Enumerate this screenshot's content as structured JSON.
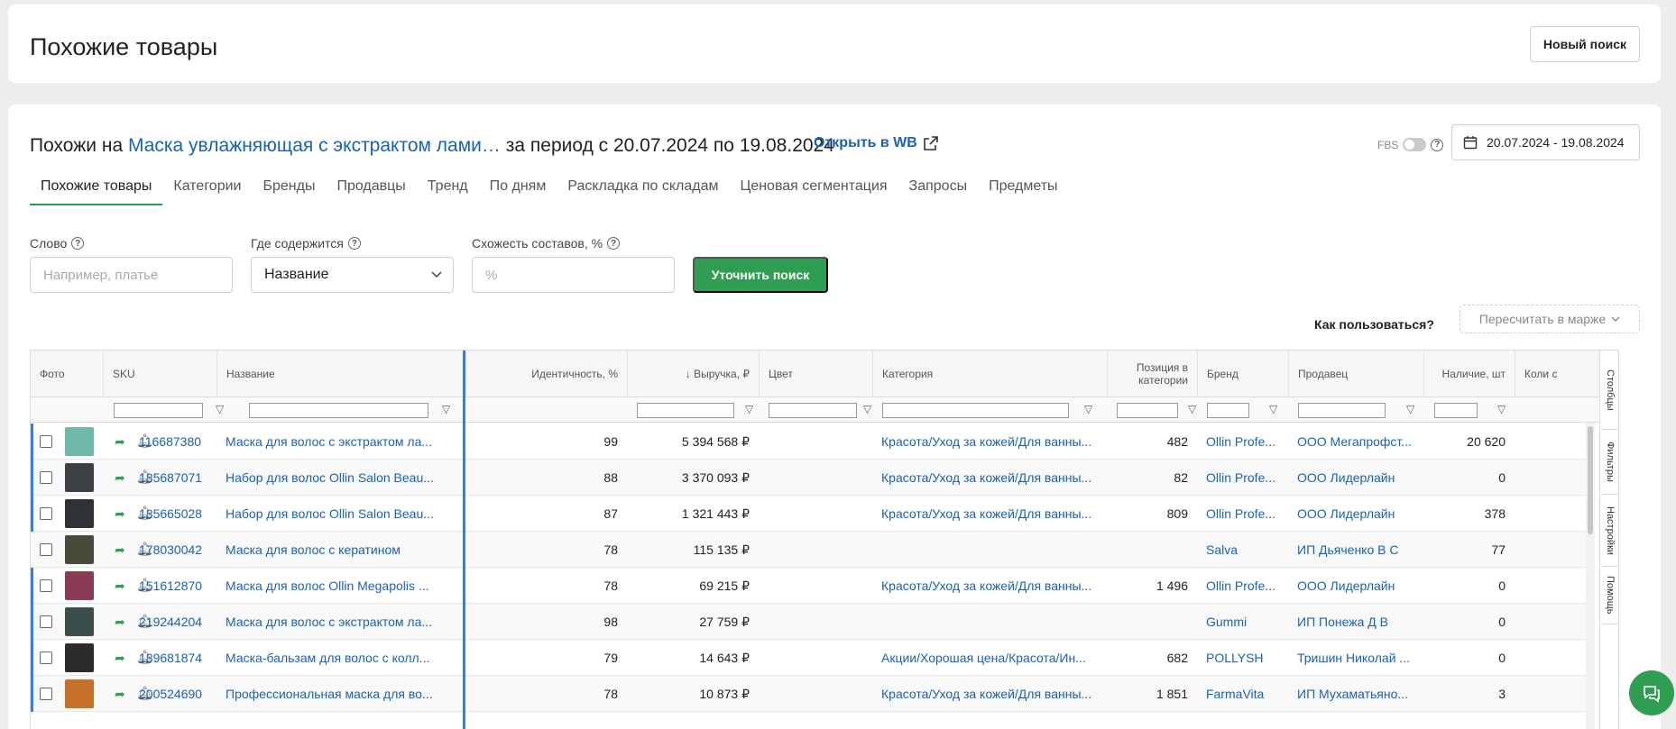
{
  "page": {
    "title": "Похожие товары",
    "new_search": "Новый поиск"
  },
  "heading": {
    "prefix": "Похожи на",
    "product_link": "Маска увлажняющая с экстрактом лами…",
    "period": "за период с 20.07.2024 по 19.08.2024",
    "open_wb": "Открыть в WB"
  },
  "fbs": {
    "label": "FBS"
  },
  "date_range": "20.07.2024 - 19.08.2024",
  "tabs": [
    "Похожие товары",
    "Категории",
    "Бренды",
    "Продавцы",
    "Тренд",
    "По дням",
    "Раскладка по складам",
    "Ценовая сегментация",
    "Запросы",
    "Предметы"
  ],
  "filters": {
    "word_label": "Слово",
    "word_placeholder": "Например, платье",
    "where_label": "Где содержится",
    "where_value": "Название",
    "similarity_label": "Схожесть составов, %",
    "similarity_placeholder": "%",
    "refine_button": "Уточнить поиск"
  },
  "howto": "Как пользоваться?",
  "recalc": "Пересчитать в марже",
  "columns": {
    "photo": "Фото",
    "sku": "SKU",
    "name": "Название",
    "identity": "Идентичность, %",
    "revenue": "↓ Выручка, ₽",
    "color": "Цвет",
    "category": "Категория",
    "position": "Позиция в категории",
    "brand": "Бренд",
    "seller": "Продавец",
    "stock": "Наличие, шт",
    "count": "Коли с"
  },
  "rows": [
    {
      "sku": "116687380",
      "name": "Маска для волос с экстрактом ла...",
      "identity": "99",
      "revenue": "5 394 568 ₽",
      "category": "Красота/Уход за кожей/Для ванны...",
      "position": "482",
      "brand": "Ollin Profe...",
      "seller": "ООО Мегапрофст...",
      "stock": "20 620",
      "thumb": "#6fb7a8"
    },
    {
      "sku": "185687071",
      "name": "Набор для волос Ollin Salon Beau...",
      "identity": "88",
      "revenue": "3 370 093 ₽",
      "category": "Красота/Уход за кожей/Для ванны...",
      "position": "82",
      "brand": "Ollin Profe...",
      "seller": "ООО Лидерлайн",
      "stock": "0",
      "thumb": "#3c3f44"
    },
    {
      "sku": "185665028",
      "name": "Набор для волос Ollin Salon Beau...",
      "identity": "87",
      "revenue": "1 321 443 ₽",
      "category": "Красота/Уход за кожей/Для ванны...",
      "position": "809",
      "brand": "Ollin Profe...",
      "seller": "ООО Лидерлайн",
      "stock": "378",
      "thumb": "#2e3136"
    },
    {
      "sku": "178030042",
      "name": "Маска для волос с кератином",
      "identity": "78",
      "revenue": "115 135 ₽",
      "category": "",
      "position": "",
      "brand": "Salva",
      "seller": "ИП Дьяченко В С",
      "stock": "77",
      "thumb": "#4a4a3a"
    },
    {
      "sku": "151612870",
      "name": "Маска для волос Ollin Megapolis ...",
      "identity": "78",
      "revenue": "69 215 ₽",
      "category": "Красота/Уход за кожей/Для ванны...",
      "position": "1 496",
      "brand": "Ollin Profe...",
      "seller": "ООО Лидерлайн",
      "stock": "0",
      "thumb": "#8a3c54"
    },
    {
      "sku": "219244204",
      "name": "Маска для волос с экстрактом ла...",
      "identity": "98",
      "revenue": "27 759 ₽",
      "category": "",
      "position": "",
      "brand": "Gummi",
      "seller": "ИП Понежа Д В",
      "stock": "0",
      "thumb": "#3a4f4c"
    },
    {
      "sku": "189681874",
      "name": "Маска-бальзам для волос с колл...",
      "identity": "79",
      "revenue": "14 643 ₽",
      "category": "Акции/Хорошая цена/Красота/Ин...",
      "position": "682",
      "brand": "POLLYSH",
      "seller": "Тришин Николай ...",
      "stock": "0",
      "thumb": "#2b2b2b"
    },
    {
      "sku": "200524690",
      "name": "Профессиональная маска для во...",
      "identity": "78",
      "revenue": "10 873 ₽",
      "category": "Красота/Уход за кожей/Для ванны...",
      "position": "1 851",
      "brand": "FarmaVita",
      "seller": "ИП Мухаматьяно...",
      "stock": "3",
      "thumb": "#c7702a"
    }
  ],
  "sidebar": [
    "Столбцы",
    "Фильтры",
    "Настройки",
    "Помощь"
  ]
}
